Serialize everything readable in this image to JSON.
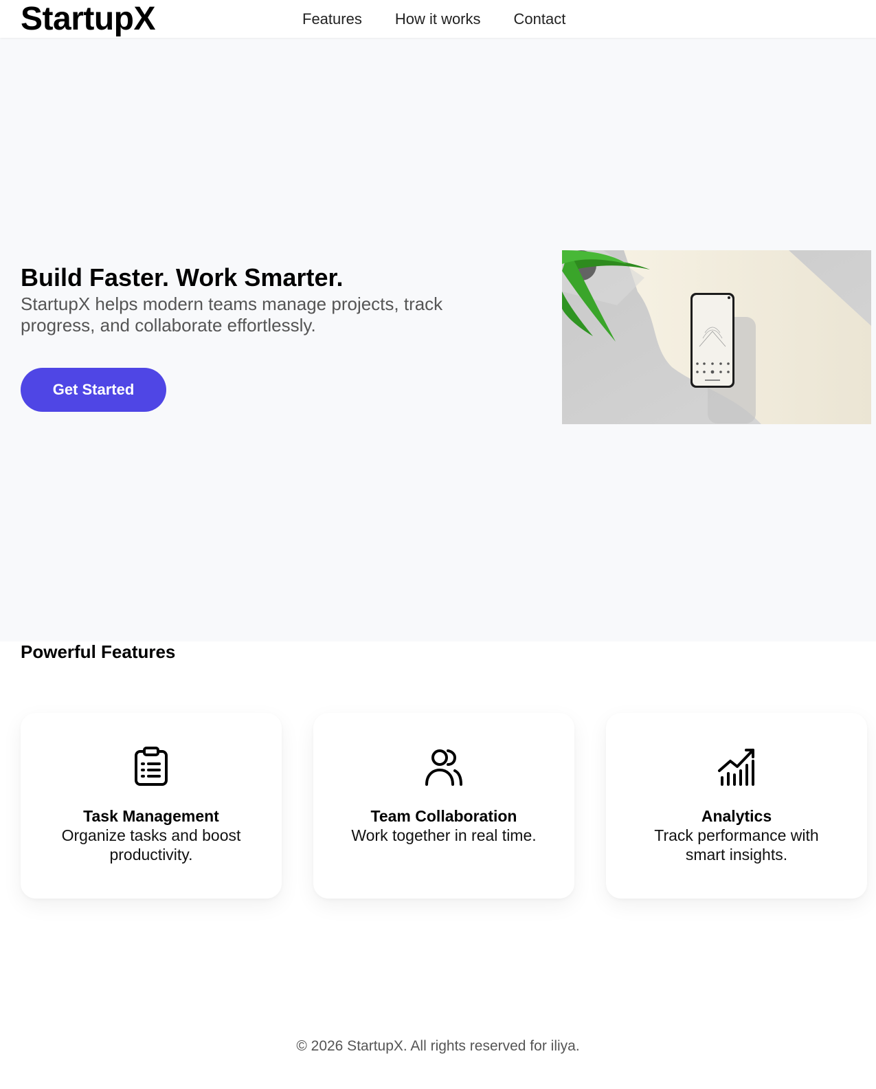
{
  "header": {
    "logo": "StartupX",
    "nav": [
      "Features",
      "How it works",
      "Contact"
    ]
  },
  "hero": {
    "title": "Build Faster. Work Smarter.",
    "subtitle": "StartupX helps modern teams manage projects, track progress, and collaborate effortlessly.",
    "cta_label": "Get Started",
    "accent_color": "#4f46e5",
    "image_description_icon": "phone-on-desk-image"
  },
  "features": {
    "heading": "Powerful Features",
    "cards": [
      {
        "icon": "clipboard-list-icon",
        "title": "Task Management",
        "desc": "Organize tasks and boost productivity."
      },
      {
        "icon": "users-icon",
        "title": "Team Collaboration",
        "desc": "Work together in real time."
      },
      {
        "icon": "chart-trending-icon",
        "title": "Analytics",
        "desc": "Track performance with smart insights."
      }
    ]
  },
  "footer": {
    "text": "© 2026 StartupX. All rights reserved for iliya."
  }
}
